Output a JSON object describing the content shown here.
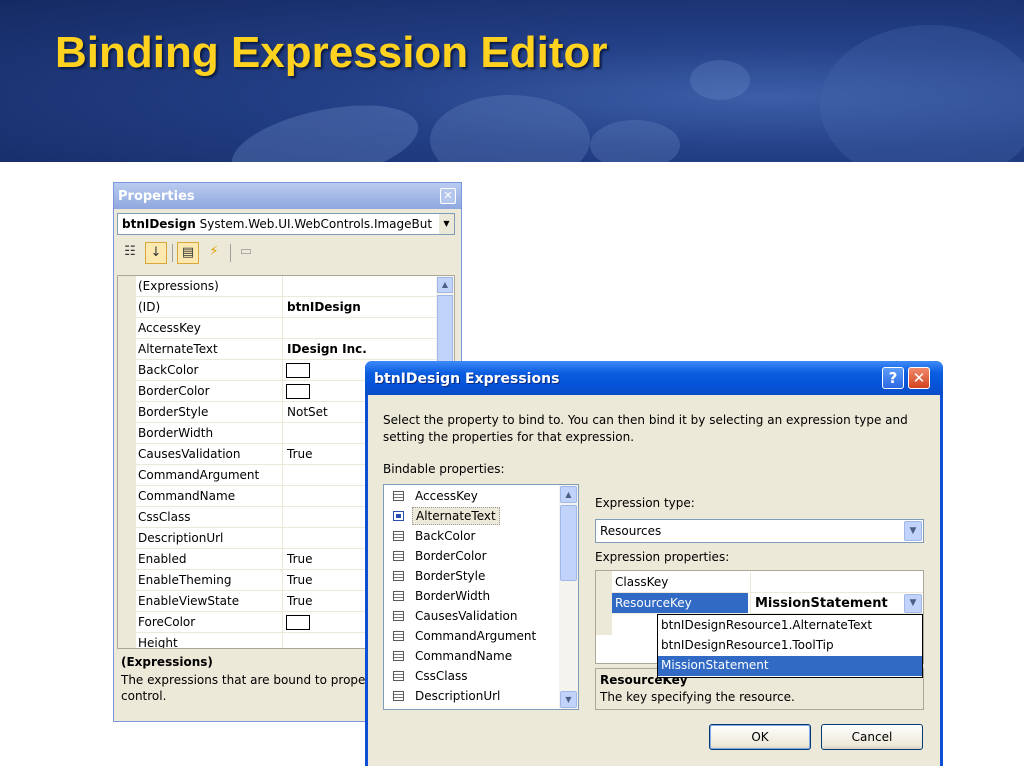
{
  "slide": {
    "title": "Binding Expression Editor"
  },
  "properties_window": {
    "title": "Properties",
    "object_name": "btnIDesign",
    "object_type": "System.Web.UI.WebControls.ImageBut",
    "toolbar": [
      "categorized-icon",
      "alphabetical-icon",
      "properties-icon",
      "events-icon",
      "property-pages-icon"
    ],
    "rows": [
      {
        "name": "(Expressions)",
        "value": ""
      },
      {
        "name": "(ID)",
        "value": "btnIDesign"
      },
      {
        "name": "AccessKey",
        "value": ""
      },
      {
        "name": "AlternateText",
        "value": "IDesign Inc."
      },
      {
        "name": "BackColor",
        "value": ""
      },
      {
        "name": "BorderColor",
        "value": ""
      },
      {
        "name": "BorderStyle",
        "value": "NotSet"
      },
      {
        "name": "BorderWidth",
        "value": ""
      },
      {
        "name": "CausesValidation",
        "value": "True"
      },
      {
        "name": "CommandArgument",
        "value": ""
      },
      {
        "name": "CommandName",
        "value": ""
      },
      {
        "name": "CssClass",
        "value": ""
      },
      {
        "name": "DescriptionUrl",
        "value": ""
      },
      {
        "name": "Enabled",
        "value": "True"
      },
      {
        "name": "EnableTheming",
        "value": "True"
      },
      {
        "name": "EnableViewState",
        "value": "True"
      },
      {
        "name": "ForeColor",
        "value": ""
      },
      {
        "name": "Height",
        "value": ""
      }
    ],
    "description": {
      "title": "(Expressions)",
      "text_line1": "The expressions that are bound to prope",
      "text_line2": "control."
    }
  },
  "expressions_dialog": {
    "title": "btnIDesign Expressions",
    "help_label": "?",
    "close_label": "✕",
    "intro_line1": "Select the property to bind to.  You can then bind it by selecting an expression type and",
    "intro_line2": "setting the properties for that expression.",
    "bindable_label": "Bindable properties:",
    "bindable_items": [
      "AccessKey",
      "AlternateText",
      "BackColor",
      "BorderColor",
      "BorderStyle",
      "BorderWidth",
      "CausesValidation",
      "CommandArgument",
      "CommandName",
      "CssClass",
      "DescriptionUrl"
    ],
    "selected_bindable": "AlternateText",
    "expression_type_label": "Expression type:",
    "expression_type_value": "Resources",
    "expression_properties_label": "Expression properties:",
    "expression_properties": [
      {
        "name": "ClassKey",
        "value": ""
      },
      {
        "name": "ResourceKey",
        "value": "MissionStatement"
      }
    ],
    "resource_key_options": [
      "btnIDesignResource1.AlternateText",
      "btnIDesignResource1.ToolTip",
      "MissionStatement"
    ],
    "selected_option": "MissionStatement",
    "description_title": "ResourceKey",
    "description_text": "The key specifying the resource.",
    "ok_label": "OK",
    "cancel_label": "Cancel"
  }
}
